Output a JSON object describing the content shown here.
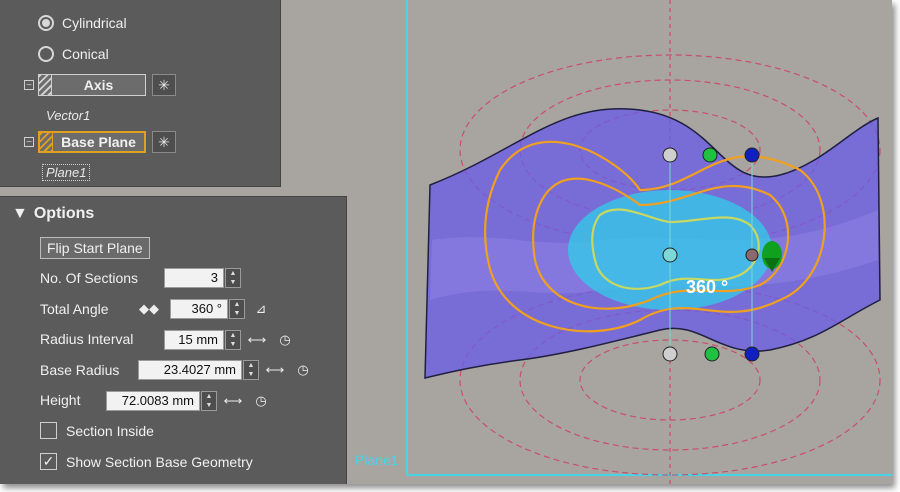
{
  "top_panel": {
    "radio_cylindrical": "Cylindrical",
    "radio_conical": "Conical",
    "axis_label": "Axis",
    "axis_value": "Vector1",
    "base_plane_label": "Base Plane",
    "base_plane_value": "Plane1"
  },
  "options": {
    "title": "Options",
    "flip_start_plane": "Flip Start Plane",
    "sections_label": "No. Of Sections",
    "sections_value": "3",
    "total_angle_label": "Total Angle",
    "total_angle_value": "360 °",
    "radius_interval_label": "Radius Interval",
    "radius_interval_value": "15 mm",
    "base_radius_label": "Base Radius",
    "base_radius_value": "23.4027 mm",
    "height_label": "Height",
    "height_value": "72.0083 mm",
    "section_inside_label": "Section Inside",
    "section_inside_checked": false,
    "show_base_geometry_label": "Show Section Base Geometry",
    "show_base_geometry_checked": true
  },
  "viewport": {
    "angle_readout": "360 °",
    "plane_label": "Plane1"
  },
  "colors": {
    "panel_bg": "#5b5b5b",
    "viewport_bg": "#a8a4a0",
    "surface": "#6a5ce6",
    "section_curve": "#f0a020",
    "active_outline": "#e0a020",
    "dashed_circles": "#d04060",
    "axis_line": "#48d4e4"
  }
}
